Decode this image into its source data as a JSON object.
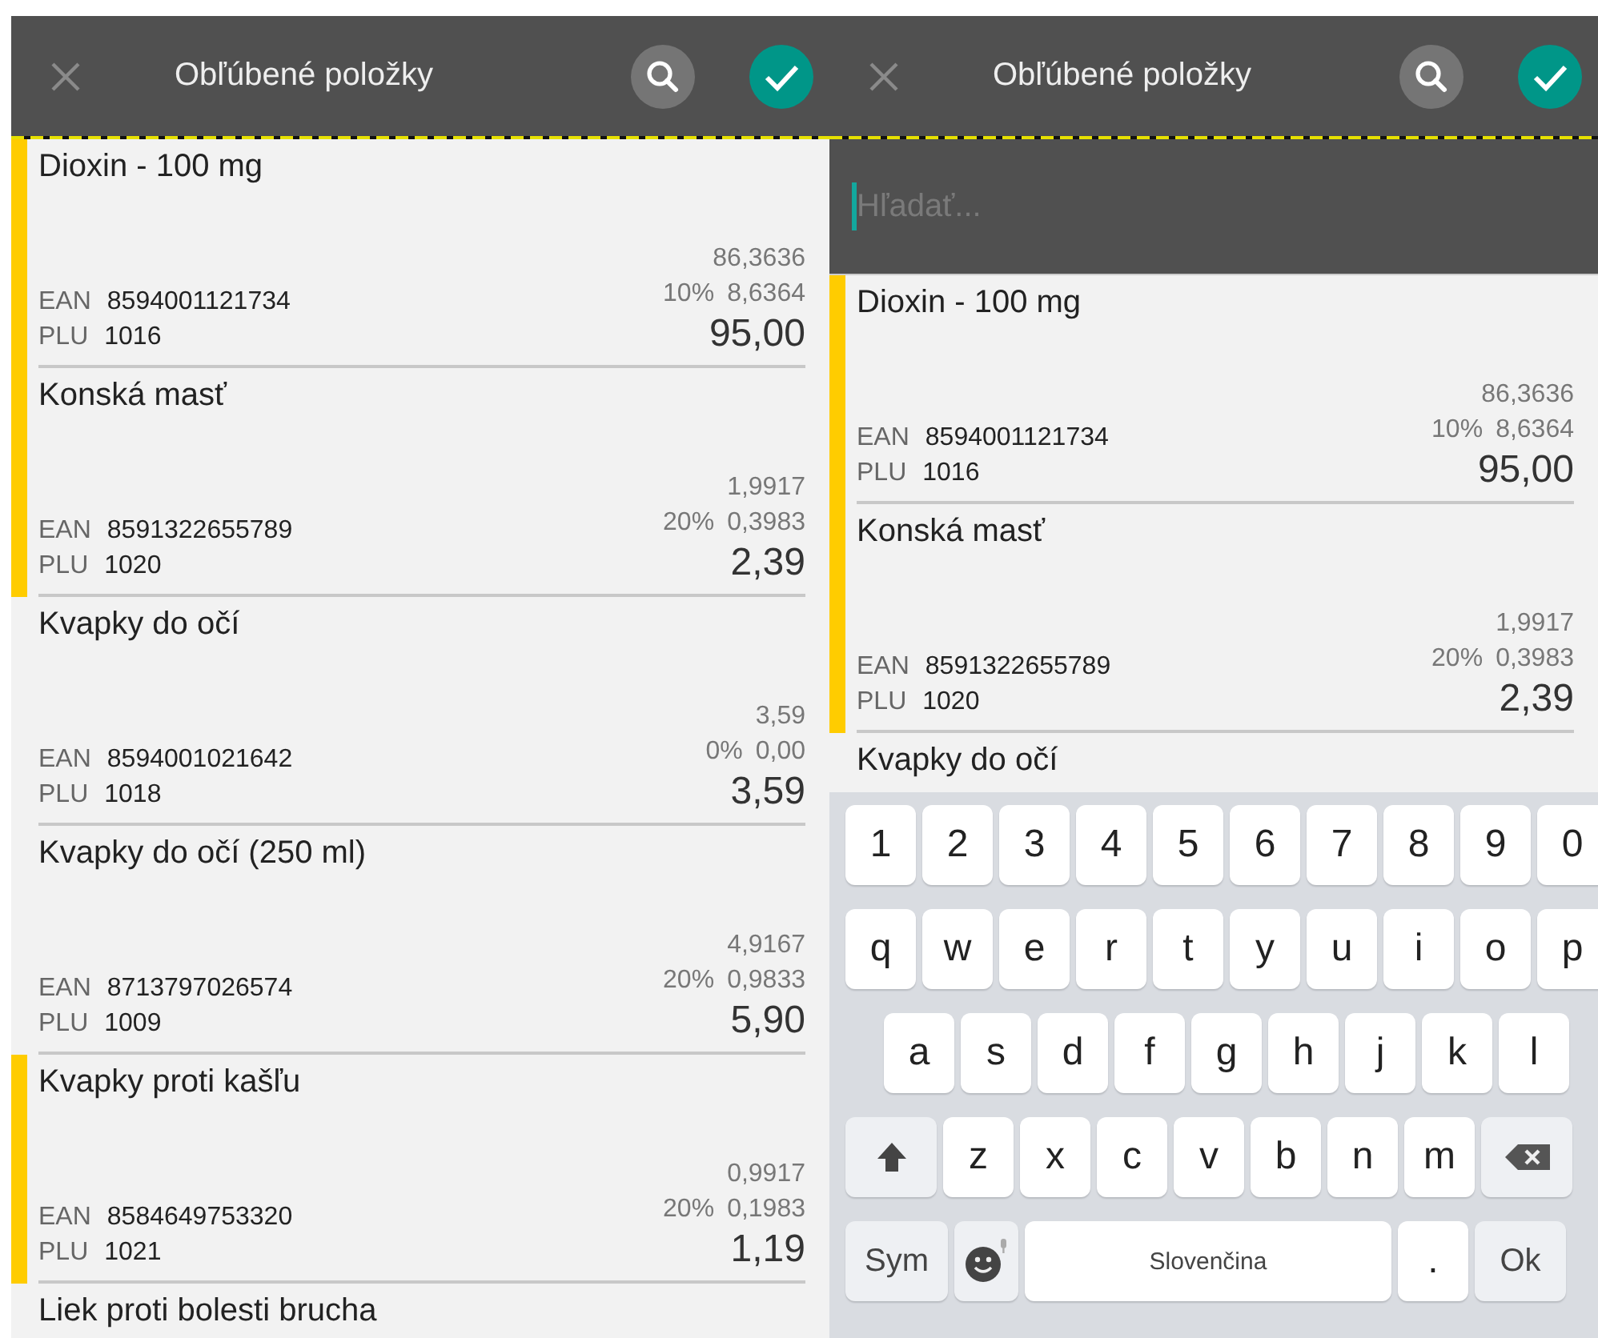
{
  "screens": [
    {
      "title": "Obľúbené položky",
      "items": [
        {
          "name": "Dioxin - 100 mg",
          "marked": true,
          "ean_label": "EAN",
          "ean": "8594001121734",
          "plu_label": "PLU",
          "plu": "1016",
          "net": "86,3636",
          "vat_rate": "10%",
          "vat": "8,6364",
          "price": "95,00"
        },
        {
          "name": "Konská masť",
          "marked": true,
          "ean_label": "EAN",
          "ean": "8591322655789",
          "plu_label": "PLU",
          "plu": "1020",
          "net": "1,9917",
          "vat_rate": "20%",
          "vat": "0,3983",
          "price": "2,39"
        },
        {
          "name": "Kvapky do očí",
          "marked": false,
          "ean_label": "EAN",
          "ean": "8594001021642",
          "plu_label": "PLU",
          "plu": "1018",
          "net": "3,59",
          "vat_rate": "0%",
          "vat": "0,00",
          "price": "3,59"
        },
        {
          "name": "Kvapky do očí (250 ml)",
          "marked": false,
          "ean_label": "EAN",
          "ean": "8713797026574",
          "plu_label": "PLU",
          "plu": "1009",
          "net": "4,9167",
          "vat_rate": "20%",
          "vat": "0,9833",
          "price": "5,90"
        },
        {
          "name": "Kvapky proti kašľu",
          "marked": true,
          "ean_label": "EAN",
          "ean": "8584649753320",
          "plu_label": "PLU",
          "plu": "1021",
          "net": "0,9917",
          "vat_rate": "20%",
          "vat": "0,1983",
          "price": "1,19"
        },
        {
          "name": "Liek proti bolesti brucha",
          "marked": false
        }
      ]
    },
    {
      "title": "Obľúbené položky",
      "search": {
        "placeholder": "Hľadať..."
      },
      "items": [
        {
          "name": "Dioxin - 100 mg",
          "marked": true,
          "ean_label": "EAN",
          "ean": "8594001121734",
          "plu_label": "PLU",
          "plu": "1016",
          "net": "86,3636",
          "vat_rate": "10%",
          "vat": "8,6364",
          "price": "95,00"
        },
        {
          "name": "Konská masť",
          "marked": true,
          "ean_label": "EAN",
          "ean": "8591322655789",
          "plu_label": "PLU",
          "plu": "1020",
          "net": "1,9917",
          "vat_rate": "20%",
          "vat": "0,3983",
          "price": "2,39"
        },
        {
          "name": "Kvapky do očí",
          "marked": false
        }
      ],
      "keyboard": {
        "rows": [
          {
            "keys": [
              {
                "kind": "char",
                "label": "1"
              },
              {
                "kind": "char",
                "label": "2"
              },
              {
                "kind": "char",
                "label": "3"
              },
              {
                "kind": "char",
                "label": "4"
              },
              {
                "kind": "char",
                "label": "5"
              },
              {
                "kind": "char",
                "label": "6"
              },
              {
                "kind": "char",
                "label": "7"
              },
              {
                "kind": "char",
                "label": "8"
              },
              {
                "kind": "char",
                "label": "9"
              },
              {
                "kind": "char",
                "label": "0"
              }
            ]
          },
          {
            "keys": [
              {
                "kind": "char",
                "label": "q"
              },
              {
                "kind": "char",
                "label": "w"
              },
              {
                "kind": "char",
                "label": "e"
              },
              {
                "kind": "char",
                "label": "r"
              },
              {
                "kind": "char",
                "label": "t"
              },
              {
                "kind": "char",
                "label": "y"
              },
              {
                "kind": "char",
                "label": "u"
              },
              {
                "kind": "char",
                "label": "i"
              },
              {
                "kind": "char",
                "label": "o"
              },
              {
                "kind": "char",
                "label": "p"
              }
            ]
          },
          {
            "keys": [
              {
                "kind": "char",
                "label": "a"
              },
              {
                "kind": "char",
                "label": "s"
              },
              {
                "kind": "char",
                "label": "d"
              },
              {
                "kind": "char",
                "label": "f"
              },
              {
                "kind": "char",
                "label": "g"
              },
              {
                "kind": "char",
                "label": "h"
              },
              {
                "kind": "char",
                "label": "j"
              },
              {
                "kind": "char",
                "label": "k"
              },
              {
                "kind": "char",
                "label": "l"
              }
            ]
          },
          {
            "keys": [
              {
                "kind": "shift"
              },
              {
                "kind": "char",
                "label": "z"
              },
              {
                "kind": "char",
                "label": "x"
              },
              {
                "kind": "char",
                "label": "c"
              },
              {
                "kind": "char",
                "label": "v"
              },
              {
                "kind": "char",
                "label": "b"
              },
              {
                "kind": "char",
                "label": "n"
              },
              {
                "kind": "char",
                "label": "m"
              },
              {
                "kind": "backspace"
              }
            ]
          },
          {
            "keys": [
              {
                "kind": "sym",
                "label": "Sym"
              },
              {
                "kind": "emoji"
              },
              {
                "kind": "space",
                "label": "Slovenčina"
              },
              {
                "kind": "char",
                "label": "."
              },
              {
                "kind": "ok",
                "label": "Ok"
              }
            ]
          }
        ]
      }
    }
  ]
}
